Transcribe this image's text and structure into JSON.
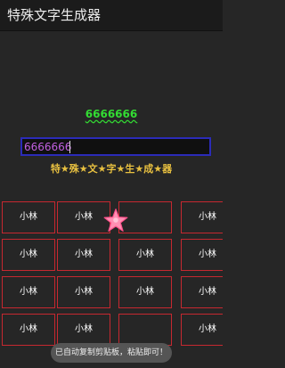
{
  "app": {
    "title": "特殊文字生成器"
  },
  "preview": {
    "text": "6666666"
  },
  "input": {
    "value": "6666666"
  },
  "style_line": {
    "text": "特★殊★文★字★生★成★器"
  },
  "grid": {
    "cells": [
      [
        "小林",
        "小林",
        "",
        "小林"
      ],
      [
        "小林",
        "小林",
        "小林",
        "小林"
      ],
      [
        "小林",
        "小林",
        "小林",
        "小林"
      ],
      [
        "小林",
        "小林",
        "",
        "小林"
      ]
    ]
  },
  "sticker": {
    "icon": "pink-star-icon"
  },
  "toast": {
    "text": "已自动复制剪贴板，粘贴即可！"
  },
  "colors": {
    "cell_border": "#c62830",
    "input_border": "#2b2bb8",
    "preview": "#33dd33",
    "style_line": "#e8c040"
  }
}
